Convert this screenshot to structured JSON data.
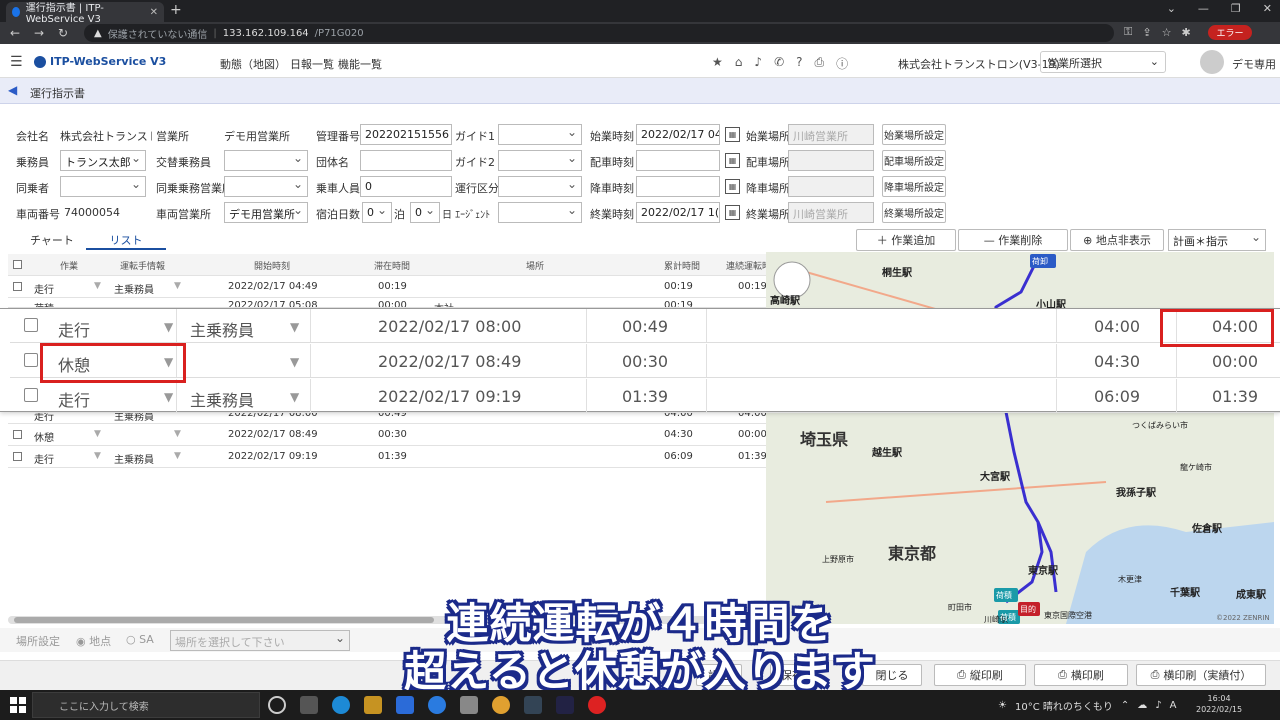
{
  "browser": {
    "tab_title": "運行指示書 | ITP-WebService V3",
    "new_tab": "+",
    "insecure_label": "保護されていない通信",
    "url_host": "133.162.109.164",
    "url_path": "/P71G020",
    "error_pill": "エラー"
  },
  "app": {
    "logo": "ITP-WebService V3",
    "menu": [
      "動態（地図）",
      "日報一覧",
      "機能一覧"
    ],
    "company": "株式会社トランストロン(V3-19)",
    "office_select": "営業所選択",
    "user": "デモ専用",
    "page_title": "運行指示書"
  },
  "form": {
    "company_label": "会社名",
    "company_value": "株式会社トランスト…",
    "office_label": "営業所",
    "office_value": "デモ用営業所",
    "mgmt_label": "管理番号",
    "mgmt_value": "202202151556",
    "guide1_label": "ガイド1",
    "guide1_value": "",
    "start_time_label": "始業時刻",
    "start_time_value": "2022/02/17 04",
    "start_place_label": "始業場所",
    "start_place_value": "川崎営業所",
    "start_place_btn": "始業場所設定",
    "crew_label": "乗務員",
    "crew_value": "トランス太郎",
    "alt_crew_label": "交替乗務員",
    "alt_crew_value": "",
    "group_label": "団体名",
    "group_value": "",
    "guide2_label": "ガイド2",
    "guide2_value": "",
    "dispatch_time_label": "配車時刻",
    "dispatch_time_value": "",
    "dispatch_place_label": "配車場所",
    "dispatch_place_value": "",
    "dispatch_place_btn": "配車場所設定",
    "passenger_label": "同乗者",
    "passenger_value": "",
    "pass_office_label": "同乗乗務営業所",
    "pass_office_value": "",
    "riders_label": "乗車人員",
    "riders_value": "0",
    "section_label": "運行区分",
    "section_value": "",
    "drop_time_label": "降車時刻",
    "drop_time_value": "",
    "drop_place_label": "降車場所",
    "drop_place_value": "",
    "drop_place_btn": "降車場所設定",
    "vehicle_label": "車両番号",
    "vehicle_value": "74000054",
    "veh_office_label": "車両営業所",
    "veh_office_value": "デモ用営業所",
    "stay_label": "宿泊日数",
    "stay_value": "0",
    "haku_label": "泊",
    "haku_value": "0",
    "agent_label": "日 ｴｰｼﾞｪﾝﾄ",
    "agent_value": "",
    "end_time_label": "終業時刻",
    "end_time_value": "2022/02/17 1(",
    "end_place_label": "終業場所",
    "end_place_value": "川崎営業所",
    "end_place_btn": "終業場所設定"
  },
  "tabs": {
    "chart": "チャート",
    "list": "リスト"
  },
  "toolbar": {
    "add": "作業追加",
    "delete": "作業削除",
    "hide_points": "地点非表示",
    "plan_select": "計画＊指示"
  },
  "table": {
    "headers": [
      "作業",
      "運転手情報",
      "開始時刻",
      "滞在時間",
      "場所",
      "累計時間",
      "連続運転時"
    ],
    "rows_top": [
      [
        "走行",
        "主乗務員",
        "2022/02/17 04:49",
        "00:19",
        "",
        "00:19",
        "00:19"
      ],
      [
        "荷積",
        "",
        "2022/02/17 05:08",
        "00:00",
        "本社",
        "00:19",
        ""
      ]
    ],
    "rows_bottom": [
      [
        "走行",
        "主乗務員",
        "2022/02/17 08:00",
        "00:49",
        "",
        "04:00",
        "04:00"
      ],
      [
        "休憩",
        "",
        "2022/02/17 08:49",
        "00:30",
        "",
        "04:30",
        "00:00"
      ],
      [
        "走行",
        "主乗務員",
        "2022/02/17 09:19",
        "01:39",
        "",
        "06:09",
        "01:39"
      ]
    ]
  },
  "zoom": {
    "rows": [
      [
        "走行",
        "主乗務員",
        "2022/02/17 08:00",
        "00:49",
        "04:00",
        "04:00"
      ],
      [
        "休憩",
        "",
        "2022/02/17 08:49",
        "00:30",
        "04:30",
        "00:00"
      ],
      [
        "走行",
        "主乗務員",
        "2022/02/17 09:19",
        "01:39",
        "06:09",
        "01:39"
      ]
    ]
  },
  "map": {
    "labels": [
      "桐生駅",
      "高崎駅",
      "小山駅",
      "埼玉県",
      "越生駅",
      "大宮駅",
      "我孫子駅",
      "東京都",
      "東京駅",
      "千葉駅",
      "佐倉駅",
      "成東駅",
      "川崎駅",
      "東京国際空港",
      "木更津",
      "つくばみらい市",
      "龍ケ崎市",
      "上野原市",
      "町田市"
    ],
    "pins": [
      "荷卸",
      "荷積",
      "荷積",
      "目的"
    ],
    "copyright": "©2022 ZENRIN"
  },
  "bottom": {
    "place_setting": "場所設定",
    "point_radio": "地点",
    "sa_radio": "SA",
    "place_placeholder": "場所を選択して下さい"
  },
  "footer": {
    "setting": "設定",
    "save": "保存",
    "close": "閉じる",
    "print_portrait": "縦印刷",
    "print_landscape": "横印刷",
    "print_actual": "横印刷（実績付）"
  },
  "caption": {
    "line1": "連続運転が４時間を",
    "line2": "超えると休憩が入ります"
  },
  "taskbar": {
    "search": "ここに入力して検索",
    "weather": "10°C 晴れのちくもり",
    "time": "16:04",
    "date": "2022/02/15",
    "ime": "A"
  },
  "colors": {
    "accent": "#1b4fa0",
    "highlight": "#d9201f",
    "caption_outline": "#1b2a8a",
    "route": "#3a2fd0"
  }
}
